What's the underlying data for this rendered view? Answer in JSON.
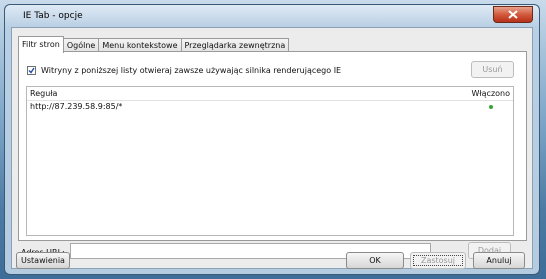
{
  "window": {
    "title": "IE Tab - opcje"
  },
  "tabs": [
    {
      "label": "Filtr stron"
    },
    {
      "label": "Ogólne"
    },
    {
      "label": "Menu kontekstowe"
    },
    {
      "label": "Przeglądarka zewnętrzna"
    }
  ],
  "filter": {
    "checkbox_label": "Witryny z poniższej listy otwieraj zawsze używając silnika renderującego IE",
    "checked": true,
    "remove_label": "Usuń",
    "columns": {
      "rule": "Reguła",
      "enabled": "Włączono"
    },
    "rows": [
      {
        "rule": "http://87.239.58.9:85/*",
        "enabled": true
      }
    ],
    "url_label": "Adres URL:",
    "url_value": "",
    "add_label": "Dodaj"
  },
  "footer": {
    "settings_label": "Ustawienia",
    "ok_label": "OK",
    "apply_label": "Zastosuj",
    "cancel_label": "Anuluj"
  },
  "colors": {
    "enabled_dot": "#3aa33a",
    "close": "#c9442a"
  }
}
